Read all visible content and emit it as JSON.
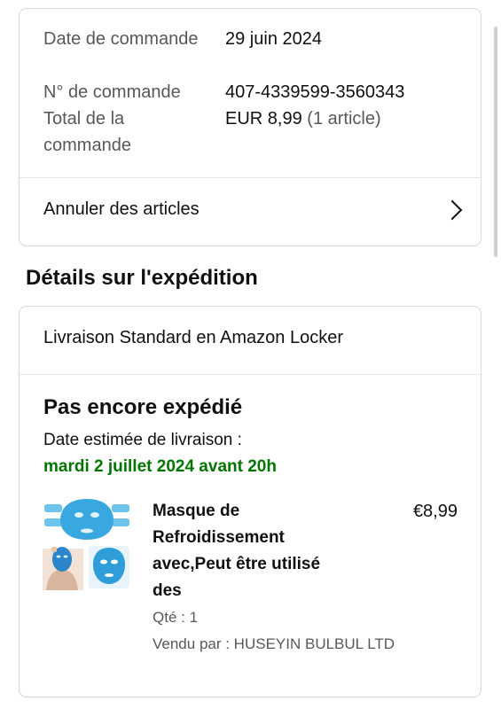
{
  "order": {
    "date_label": "Date de commande",
    "date_value": "29 juin 2024",
    "number_label": "N° de commande",
    "number_value": "407-4339599-3560343",
    "total_label": "Total de la commande",
    "total_amount": "EUR 8,99",
    "total_count": "(1 article)"
  },
  "cancel_label": "Annuler des articles",
  "shipping": {
    "section_title": "Détails sur l'expédition",
    "method": "Livraison Standard en Amazon Locker",
    "status": "Pas encore expédié",
    "estimate_label": "Date estimée de livraison :",
    "estimate_date": "mardi 2 juillet 2024 avant 20h",
    "item": {
      "title_lines": [
        "Masque de",
        "Refroidissement",
        "avec,Peut être utilisé",
        "des"
      ],
      "price": "€8,99",
      "quantity": "Qté : 1",
      "seller": "Vendu par : HUSEYIN BULBUL LTD",
      "thumbnail_icon": "product-thumbnail-icon"
    }
  },
  "colors": {
    "delivery_green": "#007600",
    "border": "#d5d9d9",
    "mask_blue": "#3aa8e0"
  }
}
